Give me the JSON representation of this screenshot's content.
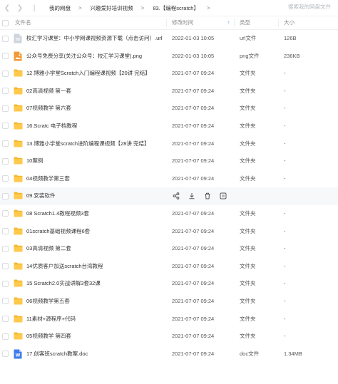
{
  "nav": {
    "breadcrumbs": [
      "我的网盘",
      "兴趣爱好培训视频",
      "83.【编程scratch】"
    ],
    "search_placeholder": "搜索我的网盘文件"
  },
  "columns": {
    "name": "文件名",
    "time": "修改时间",
    "type": "类型",
    "size": "大小"
  },
  "files": [
    {
      "name": "校汇学习课堂：中小学网课视频资源下载（点击访问）.url",
      "time": "2022-01-03 10:05",
      "type": "url文件",
      "size": "126B",
      "icon": "url-file-icon"
    },
    {
      "name": "公众号免费分享(关注公众号：校汇学习课堂).png",
      "time": "2022-01-03 10:05",
      "type": "png文件",
      "size": "236KB",
      "icon": "image-file-icon"
    },
    {
      "name": "12.博雅小学堂Scratch入门编程课视频【20讲 完结】",
      "time": "2021-07-07 09:24",
      "type": "文件夹",
      "size": "-",
      "icon": "folder-icon"
    },
    {
      "name": "02高清视频 第一套",
      "time": "2021-07-07 09:24",
      "type": "文件夹",
      "size": "-",
      "icon": "folder-icon"
    },
    {
      "name": "07视频教学 第六套",
      "time": "2021-07-07 09:24",
      "type": "文件夹",
      "size": "-",
      "icon": "folder-icon"
    },
    {
      "name": "16.Scratc 电子档教程",
      "time": "2021-07-07 09:24",
      "type": "文件夹",
      "size": "-",
      "icon": "folder-icon"
    },
    {
      "name": "13.博雅小学堂scratch进阶编程课视频【28讲 完结】",
      "time": "2021-07-07 09:24",
      "type": "文件夹",
      "size": "-",
      "icon": "folder-icon"
    },
    {
      "name": "10案例",
      "time": "2021-07-07 09:24",
      "type": "文件夹",
      "size": "-",
      "icon": "folder-icon"
    },
    {
      "name": "04视频教学第三套",
      "time": "2021-07-07 09:24",
      "type": "文件夹",
      "size": "-",
      "icon": "folder-icon"
    },
    {
      "name": "09.安装软件",
      "time": "",
      "type": "",
      "size": "",
      "icon": "folder-icon",
      "hover": true
    },
    {
      "name": "08 Scratch1.4教程视频3套",
      "time": "2021-07-07 09:24",
      "type": "文件夹",
      "size": "-",
      "icon": "folder-icon"
    },
    {
      "name": "01scratch基础视频课程6套",
      "time": "2021-07-07 09:24",
      "type": "文件夹",
      "size": "-",
      "icon": "folder-icon"
    },
    {
      "name": "03高清视频 第二套",
      "time": "2021-07-07 09:24",
      "type": "文件夹",
      "size": "-",
      "icon": "folder-icon"
    },
    {
      "name": "14优质客户加送scratch台湾教程",
      "time": "2021-07-07 09:24",
      "type": "文件夹",
      "size": "-",
      "icon": "folder-icon"
    },
    {
      "name": "15 Scratch2.0实战讲解3套32课",
      "time": "2021-07-07 09:24",
      "type": "文件夹",
      "size": "-",
      "icon": "folder-icon"
    },
    {
      "name": "06视频教学第五套",
      "time": "2021-07-07 09:24",
      "type": "文件夹",
      "size": "-",
      "icon": "folder-icon"
    },
    {
      "name": "11素材+源程序+代码",
      "time": "2021-07-07 09:24",
      "type": "文件夹",
      "size": "-",
      "icon": "folder-icon"
    },
    {
      "name": "05视频教学 第四套",
      "time": "2021-07-07 09:24",
      "type": "文件夹",
      "size": "-",
      "icon": "folder-icon"
    },
    {
      "name": "17.创客班scratch教案.doc",
      "time": "2021-07-07 09:24",
      "type": "doc文件",
      "size": "1.34MB",
      "icon": "word-file-icon"
    }
  ],
  "hover_actions": [
    "share-icon",
    "download-icon",
    "delete-icon",
    "more-icon"
  ],
  "colors": {
    "folder": "#ffc94d",
    "folder_tab": "#f5b82e",
    "accent": "#3a8bfb",
    "doc": "#3f7cf0",
    "png": "#f29a38",
    "url": "#cfd5dd"
  }
}
